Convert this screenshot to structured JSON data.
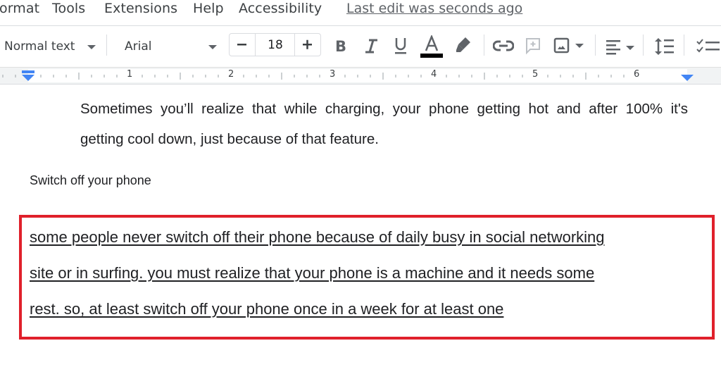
{
  "menubar": {
    "items": [
      {
        "label": "ormat"
      },
      {
        "label": "Tools"
      },
      {
        "label": "Extensions"
      },
      {
        "label": "Help"
      },
      {
        "label": "Accessibility"
      }
    ],
    "last_edit": "Last edit was seconds ago"
  },
  "toolbar": {
    "paragraph_style": "Normal text",
    "font_family": "Arial",
    "font_size": "18",
    "icons": {
      "decrease_font": "minus-icon",
      "increase_font": "plus-icon",
      "bold": "bold-icon",
      "italic": "italic-icon",
      "underline": "underline-icon",
      "text_color": "text-color-icon",
      "highlight": "highlighter-icon",
      "link": "link-icon",
      "comment": "add-comment-icon",
      "image": "insert-image-icon",
      "align": "align-left-icon",
      "line_spacing": "line-spacing-icon",
      "checklist": "checklist-icon"
    },
    "text_color_swatch": "#000000"
  },
  "ruler": {
    "numbers": [
      "1",
      "2",
      "3",
      "4",
      "5",
      "6"
    ],
    "indent_marker_color": "#4285f4"
  },
  "document": {
    "paragraph1_lines": [
      "Sometimes you’ll realize that while charging, your phone getting hot and after 100% it's",
      "getting cool down, just because of that feature."
    ],
    "heading": "Switch off your phone",
    "highlighted_lines": [
      "some people never switch off their phone because of daily busy in social networking",
      "site or in surfing. you must realize that your phone is a machine and it needs some",
      "rest. so, at least switch off your phone once in a week for at least one"
    ],
    "highlight_color": "#e0202b"
  }
}
